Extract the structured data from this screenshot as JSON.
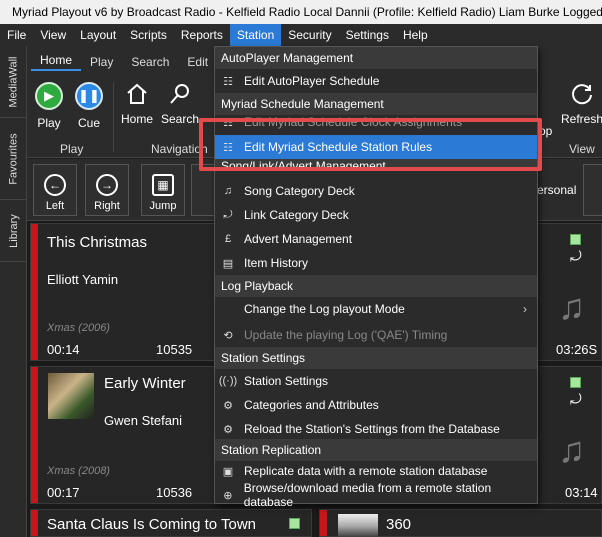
{
  "window": {
    "title": "Myriad Playout v6 by Broadcast Radio - Kelfield Radio Local Dannii (Profile: Kelfield Radio) Liam Burke Logged in"
  },
  "menubar": {
    "items": [
      "File",
      "View",
      "Layout",
      "Scripts",
      "Reports",
      "Station",
      "Security",
      "Settings",
      "Help"
    ],
    "active": "Station"
  },
  "side_tabs": [
    "MediaWall",
    "Favourites",
    "Library"
  ],
  "ribbon_tabs": [
    "Home",
    "Play",
    "Search",
    "Edit",
    "V"
  ],
  "ribbon": {
    "play_label": "Play",
    "cue_label": "Cue",
    "home_label": "Home",
    "search_label": "Search",
    "refresh_label": "Refresh",
    "group_play": "Play",
    "group_navigation": "Navigation",
    "group_view": "View",
    "partial_right_label": "op"
  },
  "toolbar2": {
    "left_label": "Left",
    "right_label": "Right",
    "jump_label": "Jump",
    "personal_label": "ersonal"
  },
  "cards": [
    {
      "title": "This Christmas",
      "artist": "Elliott Yamin",
      "meta": "Xmas (2006)",
      "time": "00:14",
      "number": "10535",
      "right_time": "03:26S"
    },
    {
      "title": "Early Winter",
      "artist": "Gwen Stefani",
      "meta": "Xmas (2008)",
      "time": "00:17",
      "number": "10536",
      "right_time": "03:14"
    },
    {
      "title": "Santa Claus Is Coming to Town",
      "number_right": "360"
    }
  ],
  "dropdown": {
    "sections": {
      "autoplayer": "AutoPlayer Management",
      "schedule": "Myriad Schedule Management",
      "song_link_advert": "Song/Link/Advert Management",
      "log_playback": "Log Playback",
      "station_settings": "Station Settings",
      "station_replication": "Station Replication"
    },
    "items": {
      "edit_autoplayer": "Edit AutoPlayer Schedule",
      "edit_clock_assignments": "Edit Myriad Schedule Clock Assignments",
      "edit_station_rules": "Edit Myriad Schedule Station Rules",
      "song_category_deck": "Song Category Deck",
      "link_category_deck": "Link Category Deck",
      "advert_management": "Advert Management",
      "item_history": "Item History",
      "change_log_mode": "Change the Log playout Mode",
      "update_log_timing": "Update the playing Log ('QAE') Timing",
      "station_settings": "Station Settings",
      "categories_attributes": "Categories and Attributes",
      "reload_settings": "Reload the Station's Settings from the Database",
      "replicate_data": "Replicate data with a remote station database",
      "browse_media": "Browse/download media from a remote station database"
    }
  },
  "colors": {
    "accent": "#2b7bd6",
    "highlight_border": "#e24b4b",
    "card_bar": "#c8161d",
    "play_green": "#2eaa3e",
    "cue_blue": "#2b88e6"
  }
}
